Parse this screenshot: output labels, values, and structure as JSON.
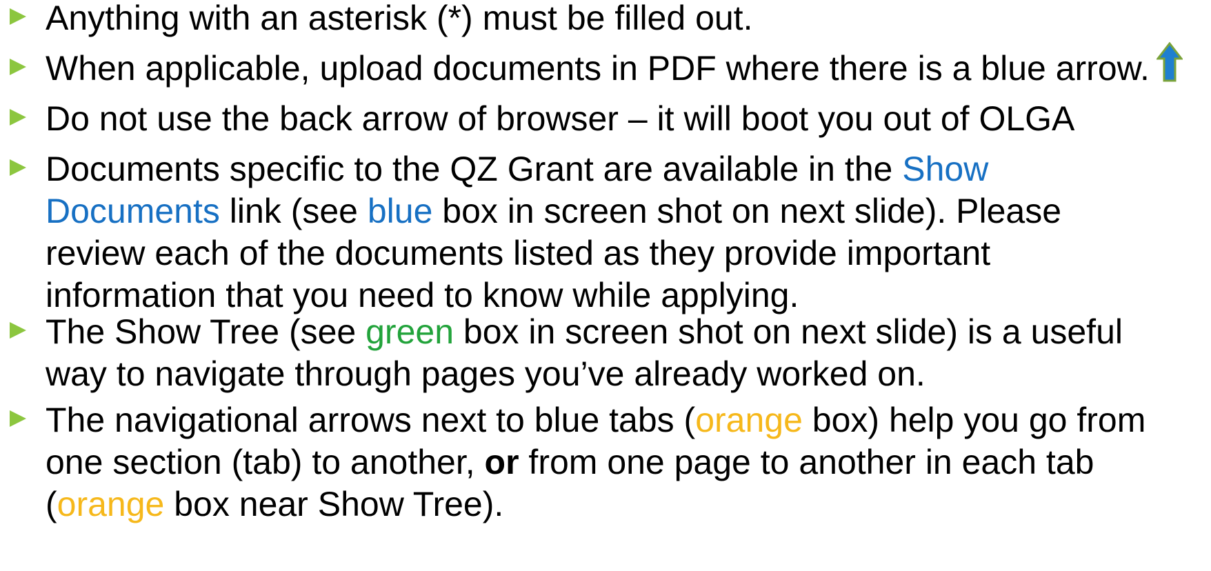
{
  "colors": {
    "bullet": "#8cc63f",
    "blue": "#1770c3",
    "green": "#22a33b",
    "orange": "#f6b81b",
    "arrow_fill": "#1f7fd0",
    "arrow_outline": "#7ba33a"
  },
  "bullets": [
    {
      "text": "Anything with an asterisk (*) must be filled out."
    },
    {
      "text": "When applicable, upload documents in PDF where there is a blue arrow.",
      "icon": "upload-arrow-icon"
    },
    {
      "text": "Do not use the back arrow of browser – it will boot you out of OLGA"
    },
    {
      "l1_a": "Documents specific to the QZ Grant are available in the ",
      "l1_b": "Show",
      "l2_a": "Documents",
      "l2_b": " link (see ",
      "l2_c": "blue",
      "l2_d": " box in screen shot on next slide). Please",
      "l3": "review each of the documents listed as they provide important",
      "l4": "information that you need to know while applying."
    },
    {
      "l1_a": "The Show Tree (see ",
      "l1_b": "green",
      "l1_c": " box in screen shot on next slide) is a useful",
      "l2": "way to navigate through pages you’ve already worked on."
    },
    {
      "l1_a": "The navigational arrows next to blue tabs (",
      "l1_b": "orange",
      "l1_c": " box) help you go from",
      "l2_a": "one section (tab) to another, ",
      "l2_b": "or",
      "l2_c": " from one page to another in each tab",
      "l3_a": "(",
      "l3_b": "orange",
      "l3_c": " box near Show Tree)."
    }
  ]
}
